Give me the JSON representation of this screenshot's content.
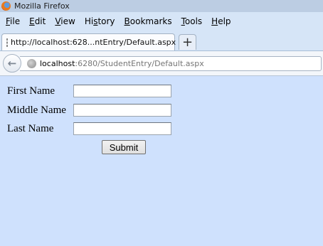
{
  "window": {
    "title": "Mozilla Firefox"
  },
  "menu": [
    {
      "mnemonic": "F",
      "rest": "ile"
    },
    {
      "mnemonic": "E",
      "rest": "dit"
    },
    {
      "mnemonic": "V",
      "rest": "iew"
    },
    {
      "pre": "Hi",
      "mnemonic": "s",
      "rest": "tory"
    },
    {
      "mnemonic": "B",
      "rest": "ookmarks"
    },
    {
      "mnemonic": "T",
      "rest": "ools"
    },
    {
      "mnemonic": "H",
      "rest": "elp"
    }
  ],
  "tab": {
    "title": "http://localhost:628...ntEntry/Default.aspx",
    "icon": "page-icon"
  },
  "new_tab": {
    "label": "+"
  },
  "address": {
    "host": "localhost",
    "path": ":6280/StudentEntry/Default.aspx",
    "icon": "globe-icon"
  },
  "form": {
    "first_name_label": "First Name",
    "first_name_value": "",
    "middle_name_label": "Middle Name",
    "middle_name_value": "",
    "last_name_label": "Last Name",
    "last_name_value": "",
    "submit_label": "Submit"
  },
  "colors": {
    "title_bar": "#bccde3",
    "chrome": "#d6e5f7",
    "page_background": "#cfe1fd"
  }
}
